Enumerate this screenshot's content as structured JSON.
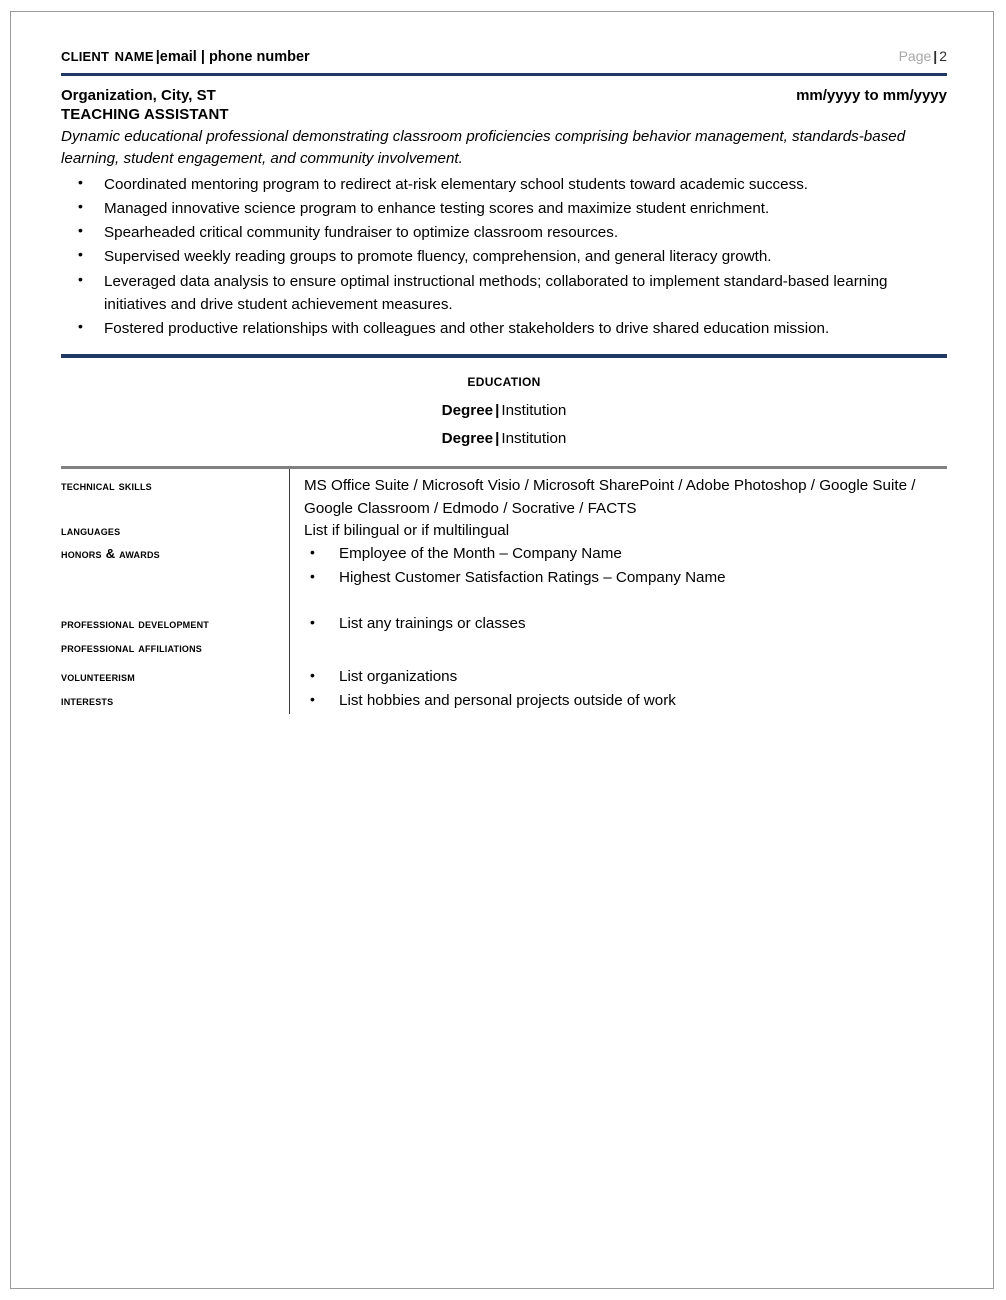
{
  "header": {
    "client_name": "Client Name",
    "contact_info": "|email | phone number",
    "page_label": "Page",
    "page_separator": "|",
    "page_number": "2",
    "rule_color": "#1f3864"
  },
  "experience": {
    "organization": "Organization, City, ST",
    "dates": "mm/yyyy to mm/yyyy",
    "job_title": "TEACHING ASSISTANT",
    "summary": "Dynamic educational professional demonstrating classroom proficiencies comprising behavior management, standards-based learning, student engagement, and community involvement.",
    "bullets": [
      "Coordinated mentoring program to redirect at-risk elementary school students toward academic success.",
      "Managed innovative science program to enhance testing scores and maximize student enrichment.",
      "Spearheaded critical community fundraiser to optimize classroom resources.",
      "Supervised weekly reading groups to promote fluency, comprehension, and general literacy growth.",
      "Leveraged data analysis to ensure optimal instructional methods; collaborated to implement standard-based learning initiatives and drive student achievement measures.",
      "Fostered productive relationships with colleagues and other stakeholders to drive shared education mission."
    ]
  },
  "education": {
    "heading": "Education",
    "entries": [
      {
        "degree": "Degree",
        "separator": "|",
        "institution": "Institution"
      },
      {
        "degree": "Degree",
        "separator": "|",
        "institution": "Institution"
      }
    ]
  },
  "skills_table": {
    "border_color": "#808080",
    "technical_skills": {
      "label": "Technical Skills",
      "value": "MS Office Suite / Microsoft Visio / Microsoft SharePoint / Adobe Photoshop / Google Suite / Google Classroom / Edmodo / Socrative / FACTS"
    },
    "languages": {
      "label": "Languages",
      "value": "List if bilingual or if multilingual"
    },
    "honors_awards": {
      "label": "Honors & Awards",
      "bullets": [
        "Employee of the Month – Company Name",
        "Highest Customer Satisfaction Ratings – Company Name"
      ]
    },
    "professional_development": {
      "label": "Professional Development",
      "bullets": [
        "List any trainings or classes"
      ]
    },
    "professional_affiliations": {
      "label": "Professional Affiliations"
    },
    "volunteerism": {
      "label": "Volunteerism",
      "bullets": [
        "List organizations"
      ]
    },
    "interests": {
      "label": "Interests",
      "bullets": [
        "List hobbies and personal projects outside of work"
      ]
    }
  }
}
